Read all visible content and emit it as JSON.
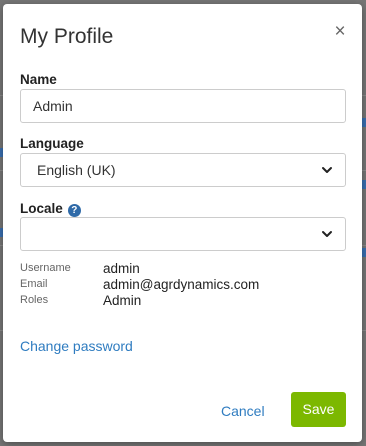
{
  "dialog": {
    "title": "My Profile",
    "close_glyph": "×"
  },
  "fields": {
    "name_label": "Name",
    "name_value": "Admin",
    "language_label": "Language",
    "language_selected": "English (UK)",
    "locale_label": "Locale",
    "locale_selected": "",
    "help_glyph": "?"
  },
  "account": {
    "username_label": "Username",
    "username_value": "admin",
    "email_label": "Email",
    "email_value": "admin@agrdynamics.com",
    "roles_label": "Roles",
    "roles_value": "Admin"
  },
  "links": {
    "change_password": "Change password"
  },
  "actions": {
    "cancel_label": "Cancel",
    "save_label": "Save"
  },
  "colors": {
    "link": "#2f7cc0",
    "save_button": "#7cb800",
    "help_icon": "#2f6aa8"
  },
  "icons": {
    "close": "close-icon",
    "help": "question-circle-icon",
    "dropdown": "chevron-down-icon"
  }
}
